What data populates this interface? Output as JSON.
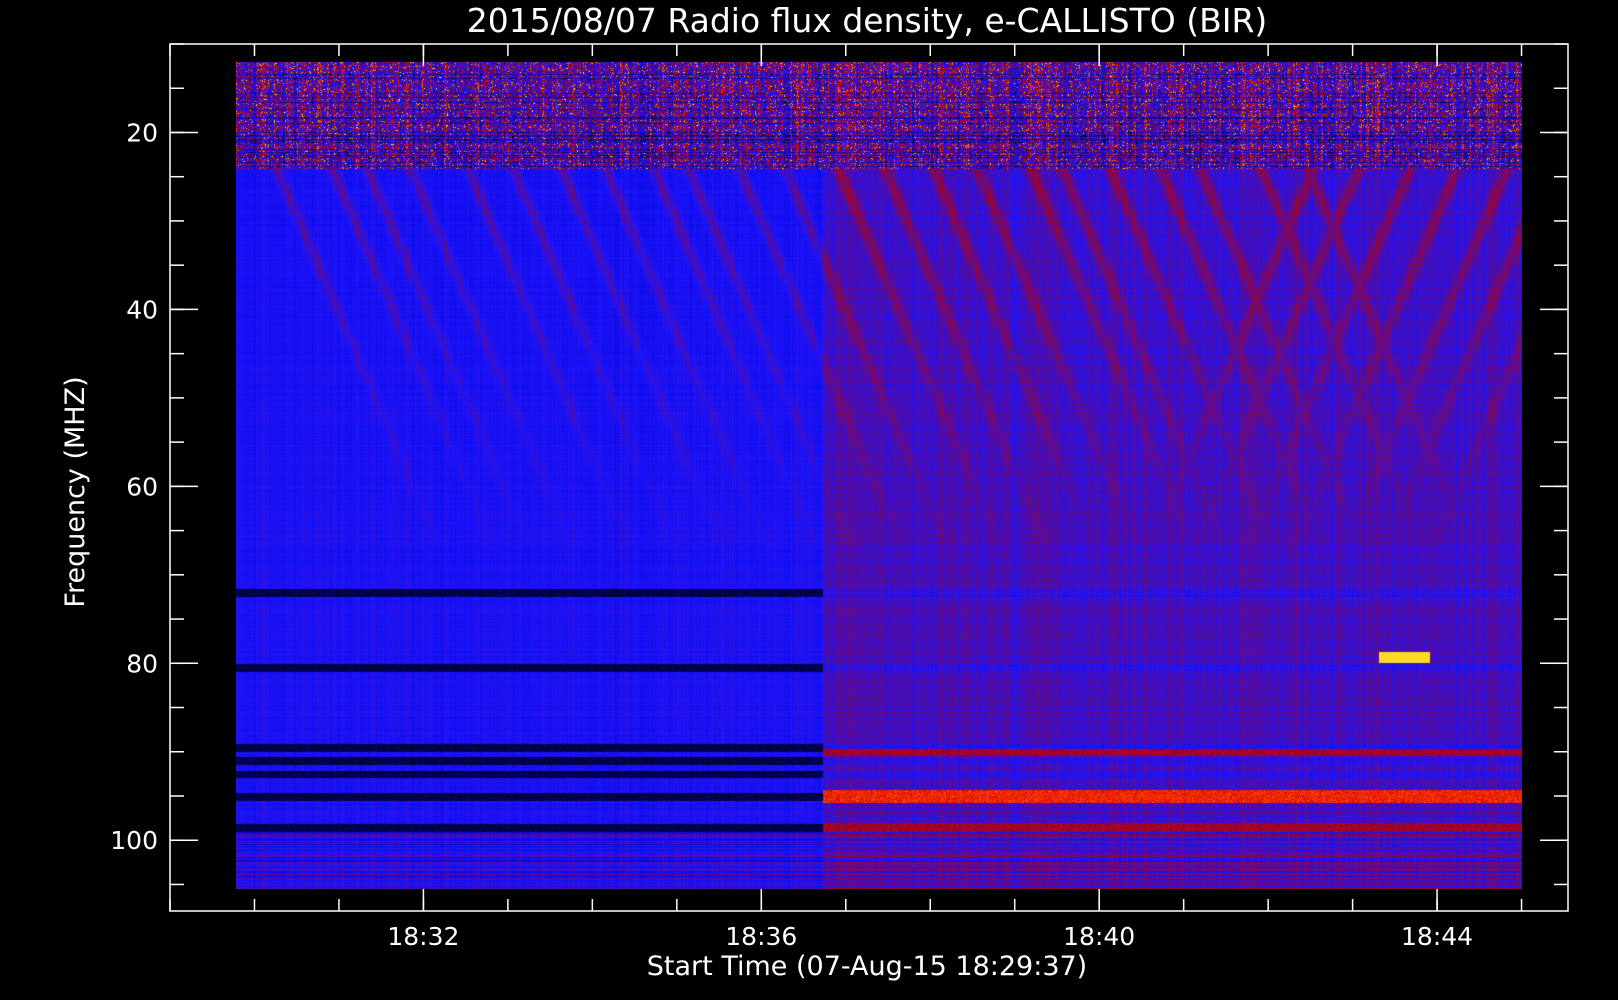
{
  "chart_data": {
    "type": "heatmap",
    "title": "2015/08/07  Radio flux density, e-CALLISTO (BIR)",
    "xlabel": "Start Time (07-Aug-15 18:29:37)",
    "ylabel": "Frequency (MHZ)",
    "x_ticks": [
      {
        "label": "18:32",
        "minutes": 32
      },
      {
        "label": "18:36",
        "minutes": 36
      },
      {
        "label": "18:40",
        "minutes": 40
      },
      {
        "label": "18:44",
        "minutes": 44
      }
    ],
    "x_range_minutes": [
      29.0,
      45.55
    ],
    "data_time_range_minutes": [
      29.78,
      45.0
    ],
    "y_ticks": [
      20,
      40,
      60,
      80,
      100
    ],
    "y_range": [
      10,
      108
    ],
    "data_freq_range": [
      12,
      105.5
    ],
    "y_inverted": true,
    "colormap": [
      "#000000",
      "#0000ff",
      "#8b0000",
      "#ff3000",
      "#ffff00"
    ],
    "features": {
      "background_shift_minutes": 36.72,
      "interference_band_freq_range": [
        12,
        24
      ],
      "absorption_lines_mhz": [
        72,
        80.5,
        89.5,
        91,
        92.5,
        95,
        98.5
      ],
      "strong_emission_line_mhz": 95,
      "spot_time_range_minutes": [
        43.3,
        43.9
      ],
      "spot_freq_mhz": 79.3
    }
  }
}
